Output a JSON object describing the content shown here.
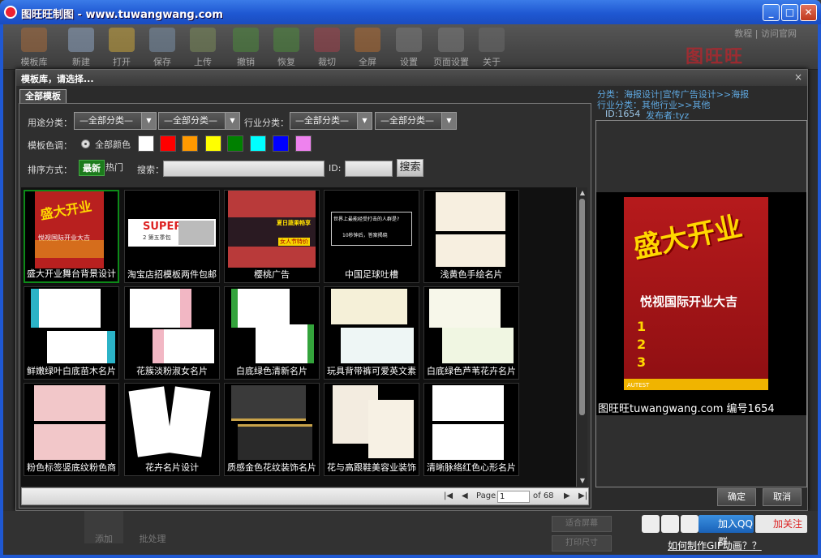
{
  "window": {
    "title": "图旺旺制图 - www.tuwangwang.com",
    "controls": [
      "_",
      "□",
      "✕"
    ]
  },
  "toolbar": {
    "buttons": [
      {
        "label": "模板库",
        "icon": "house-icon"
      },
      {
        "label": "新建",
        "icon": "new-file-icon"
      },
      {
        "label": "打开",
        "icon": "folder-icon"
      },
      {
        "label": "保存",
        "icon": "save-disk-icon"
      },
      {
        "label": "上传",
        "icon": "upload-icon"
      },
      {
        "label": "撤销",
        "icon": "undo-arrow-icon"
      },
      {
        "label": "恢复",
        "icon": "redo-arrow-icon"
      },
      {
        "label": "裁切",
        "icon": "scissors-icon"
      },
      {
        "label": "全屏",
        "icon": "fullscreen-icon"
      },
      {
        "label": "设置",
        "icon": "gear-icon"
      },
      {
        "label": "页面设置",
        "icon": "page-gear-icon"
      },
      {
        "label": "关于",
        "icon": "question-icon"
      }
    ],
    "links": {
      "tutorial": "教程",
      "separator": "|",
      "official": "访问官网"
    },
    "logo": "图旺旺"
  },
  "dialog": {
    "title": "模板库，请选择...",
    "close": "×",
    "tab": "全部模板",
    "filters": {
      "usage_label": "用途分类：",
      "usage_value_1": "—全部分类—",
      "usage_value_2": "—全部分类—",
      "industry_label": "行业分类：",
      "industry_value_1": "—全部分类—",
      "industry_value_2": "—全部分类—",
      "color_label": "模板色调：",
      "all_colors": "全部颜色",
      "swatches": [
        "#ffffff",
        "#ff0000",
        "#ff9900",
        "#ffff00",
        "#008000",
        "#00ffff",
        "#0000ff",
        "#ee82ee"
      ],
      "sort_label": "排序方式：",
      "sort_newest": "最新",
      "sort_hot": "热门",
      "search_label": "搜索：",
      "search_value": "",
      "id_label": "ID:",
      "id_value": "",
      "search_button": "搜索"
    },
    "templates": [
      "盛大开业舞台背景设计",
      "淘宝店招模板两件包邮",
      "樱桃广告",
      "中国足球吐槽",
      "浅黄色手绘名片",
      "鲜嫩绿叶白底苗木名片",
      "花簇淡粉淑女名片",
      "白底绿色清新名片",
      "玩具背带裤可爱英文素",
      "白底绿色芦苇花卉名片",
      "粉色标签竖底纹粉色商",
      "花卉名片设计",
      "质感金色花纹装饰名片",
      "花与高跟鞋美容业装饰",
      "清晰脉络红色心形名片"
    ],
    "thumb_text": {
      "t1_big": "盛大开业",
      "t1_sub": "悦视国际开业大吉",
      "t2_big": "SUPEP",
      "t2_sub": "2 第五季包",
      "t3_sub": "夏日蔬果畅享",
      "t3_tag": "女人节特价",
      "t4_line1": "世界上最能经受打击的人群是?",
      "t4_line2": "10秒钟后，答案揭晓"
    },
    "pager": {
      "page_label": "Page",
      "page_value": "1",
      "of_label": "of 68"
    },
    "info": {
      "category": "分类：海报设计|宣传广告设计>>海报",
      "industry": "行业分类：其他行业>>其他",
      "id": "ID:1654",
      "publisher": "发布者:tyz"
    },
    "preview": {
      "headline": "盛大开业",
      "subhead": "悦视国际开业大吉",
      "lines": [
        "1",
        "2",
        "3"
      ],
      "footer_left": "AUTEST",
      "caption": "图旺旺tuwangwang.com 编号1654"
    },
    "ok_button": "确定",
    "cancel_button": "取消"
  },
  "bottom": {
    "add": "添加",
    "batch": "批处理",
    "fit_screen": "适合屏幕",
    "print_size": "打印尺寸",
    "qq_group": "加入QQ群",
    "weibo": "加关注",
    "gif_link": "如何制作GIF动画？？"
  }
}
